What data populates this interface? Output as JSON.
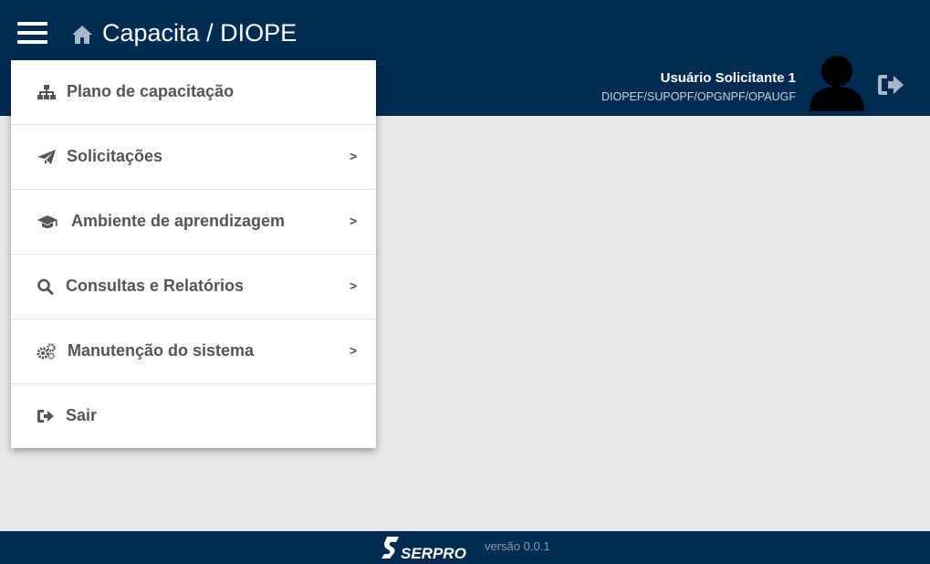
{
  "header": {
    "title": "Capacita / DIOPE",
    "menu_icon": "hamburger-icon",
    "home_icon": "home-icon"
  },
  "user": {
    "name": "Usuário Solicitante 1",
    "org": "DIOPEF/SUPOPF/OPGNPF/OPAUGF",
    "avatar_icon": "user-avatar-icon",
    "logout_icon": "logout-icon"
  },
  "menu": {
    "items": [
      {
        "label": "Plano de capacitação",
        "icon": "sitemap-icon",
        "has_submenu": false
      },
      {
        "label": "Solicitações",
        "icon": "paper-plane-icon",
        "has_submenu": true,
        "arrow": ">"
      },
      {
        "label": "Ambiente de aprendizagem",
        "icon": "graduation-cap-icon",
        "has_submenu": true,
        "arrow": ">"
      },
      {
        "label": "Consultas e Relatórios",
        "icon": "search-icon",
        "has_submenu": true,
        "arrow": ">"
      },
      {
        "label": "Manutenção do sistema",
        "icon": "gears-icon",
        "has_submenu": true,
        "arrow": ">"
      },
      {
        "label": "Sair",
        "icon": "sign-out-icon",
        "has_submenu": false
      }
    ]
  },
  "footer": {
    "logo_text": "SERPRO",
    "version": "versão 0.0.1"
  },
  "colors": {
    "header_bg": "#002b52",
    "content_bg": "#e8e8e8",
    "menu_text": "#555555"
  }
}
